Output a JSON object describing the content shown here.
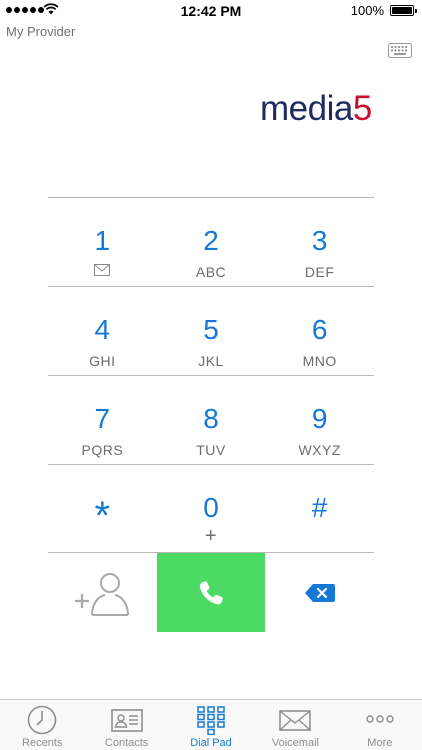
{
  "status_bar": {
    "time": "12:42 PM",
    "battery_percent": "100%",
    "battery_level": 1.0,
    "signal_bars": 5
  },
  "provider": "My Provider",
  "logo": {
    "part1": "media",
    "part2": "5"
  },
  "colors": {
    "accent": "#1478d4",
    "call_green": "#4cd964",
    "logo_blue": "#1f2a5e",
    "logo_red": "#c8102e"
  },
  "keypad": {
    "rows": [
      [
        {
          "digit": "1",
          "sub": "",
          "sub_icon": "voicemail-envelope-icon"
        },
        {
          "digit": "2",
          "sub": "ABC"
        },
        {
          "digit": "3",
          "sub": "DEF"
        }
      ],
      [
        {
          "digit": "4",
          "sub": "GHI"
        },
        {
          "digit": "5",
          "sub": "JKL"
        },
        {
          "digit": "6",
          "sub": "MNO"
        }
      ],
      [
        {
          "digit": "7",
          "sub": "PQRS"
        },
        {
          "digit": "8",
          "sub": "TUV"
        },
        {
          "digit": "9",
          "sub": "WXYZ"
        }
      ],
      [
        {
          "digit": "*",
          "sub": ""
        },
        {
          "digit": "0",
          "sub": "+"
        },
        {
          "digit": "#",
          "sub": ""
        }
      ]
    ]
  },
  "actions": {
    "add_contact_icon": "add-contact-icon",
    "call_icon": "phone-icon",
    "backspace_icon": "backspace-icon"
  },
  "tabs": [
    {
      "label": "Recents",
      "icon": "clock-icon",
      "active": false
    },
    {
      "label": "Contacts",
      "icon": "contact-card-icon",
      "active": false
    },
    {
      "label": "Dial Pad",
      "icon": "dial-pad-icon",
      "active": true
    },
    {
      "label": "Voicemail",
      "icon": "envelope-icon",
      "active": false
    },
    {
      "label": "More",
      "icon": "more-dots-icon",
      "active": false
    }
  ]
}
